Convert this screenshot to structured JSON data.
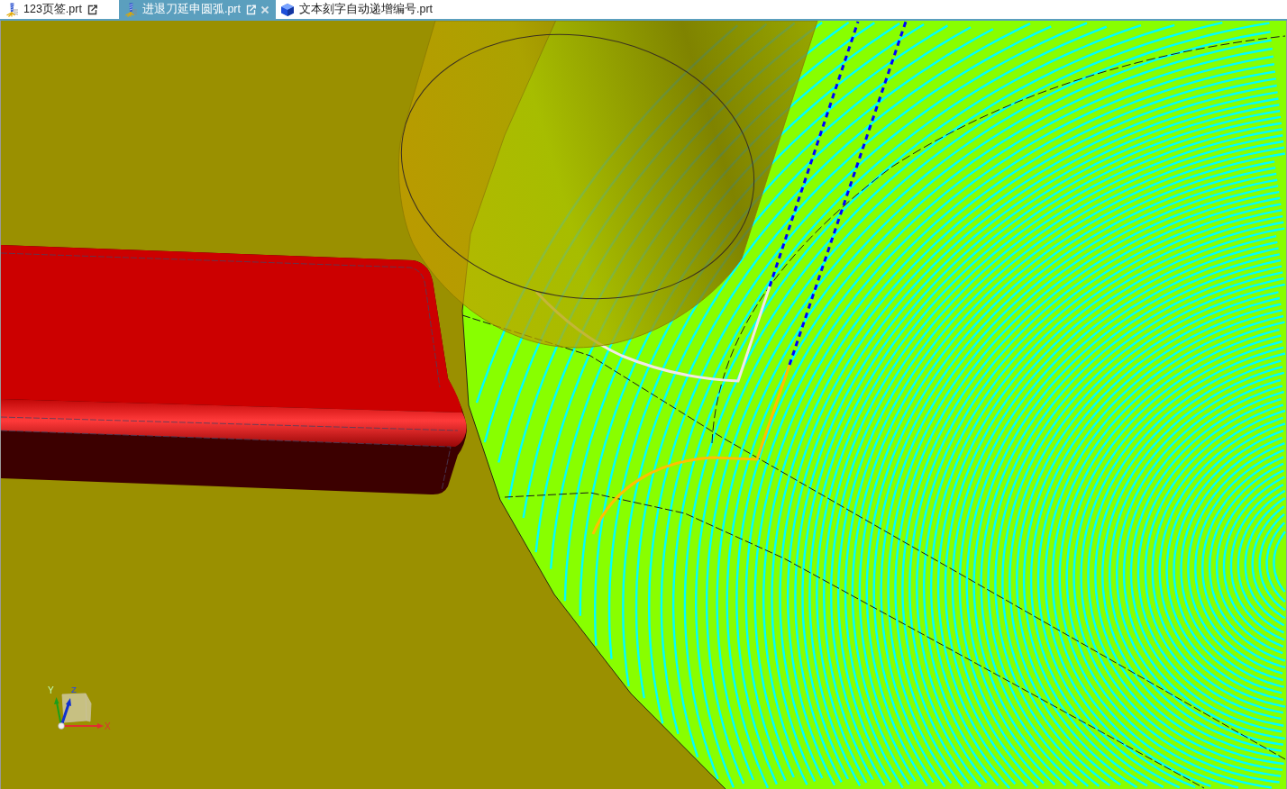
{
  "tabs": [
    {
      "label": "123页签.prt",
      "kind": "machining",
      "selected": false,
      "popout": true,
      "closable": false
    },
    {
      "label": "进退刀延申圆弧.prt",
      "kind": "machining",
      "selected": true,
      "popout": true,
      "closable": true
    },
    {
      "label": "文本刻字自动递增编号.prt",
      "kind": "modeling",
      "selected": false,
      "popout": false,
      "closable": false
    }
  ],
  "viewport": {
    "triad": {
      "x_label": "X",
      "y_label": "Y",
      "z_label": "Z"
    }
  }
}
